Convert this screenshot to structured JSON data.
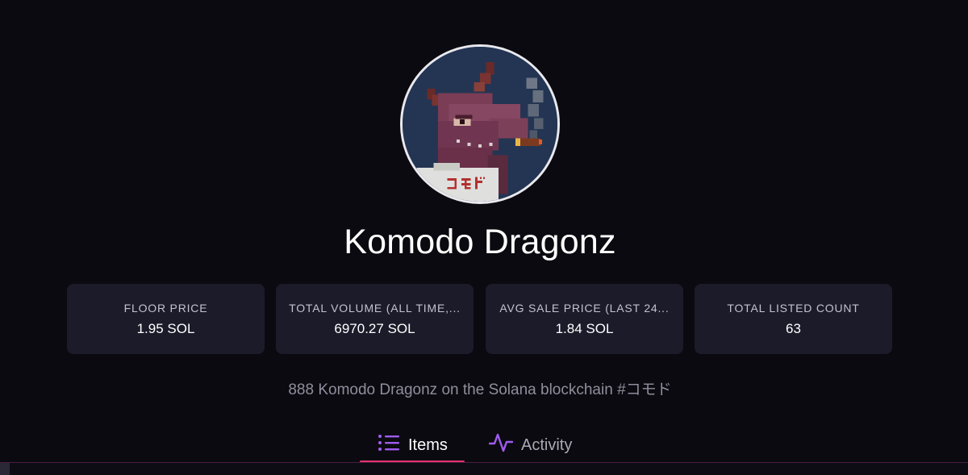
{
  "collection": {
    "name": "Komodo Dragonz",
    "description": "888 Komodo Dragonz on the Solana blockchain #コモド",
    "avatar_shirt_text": "コモド"
  },
  "stats": [
    {
      "label": "FLOOR PRICE",
      "value": "1.95 SOL"
    },
    {
      "label": "TOTAL VOLUME (ALL TIME,...",
      "value": "6970.27 SOL"
    },
    {
      "label": "AVG SALE PRICE (LAST 24...",
      "value": "1.84 SOL"
    },
    {
      "label": "TOTAL LISTED COUNT",
      "value": "63"
    }
  ],
  "tabs": {
    "items": {
      "label": "Items",
      "icon": "list-icon",
      "active": true
    },
    "activity": {
      "label": "Activity",
      "icon": "activity-icon",
      "active": false
    }
  },
  "colors": {
    "background": "#0b0a10",
    "card": "#1c1b2a",
    "accent": "#e4336f",
    "icon_purple": "#a05cf0"
  }
}
